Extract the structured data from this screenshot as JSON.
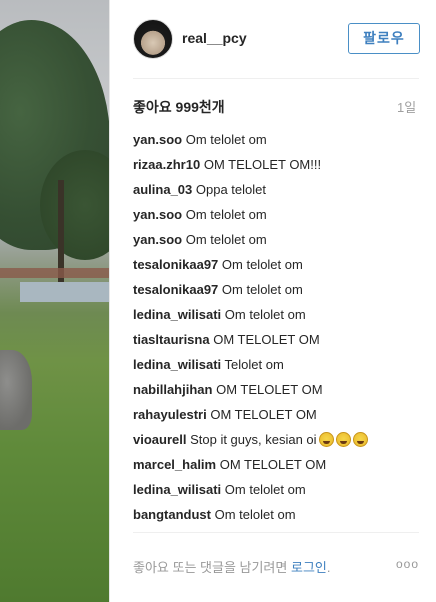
{
  "post": {
    "username": "real__pcy",
    "follow_label": "팔로우",
    "likes_text": "좋아요 999천개",
    "time_ago": "1일"
  },
  "comments": [
    {
      "user": "yan.soo",
      "text": "Om telolet om"
    },
    {
      "user": "rizaa.zhr10",
      "text": "OM TELOLET OM!!!"
    },
    {
      "user": "aulina_03",
      "text": "Oppa telolet"
    },
    {
      "user": "yan.soo",
      "text": "Om telolet om"
    },
    {
      "user": "yan.soo",
      "text": "Om telolet om"
    },
    {
      "user": "tesalonikaa97",
      "text": "Om telolet om"
    },
    {
      "user": "tesalonikaa97",
      "text": "Om telolet om"
    },
    {
      "user": "ledina_wilisati",
      "text": "Om telolet om"
    },
    {
      "user": "tiasltaurisna",
      "text": "OM TELOLET OM"
    },
    {
      "user": "ledina_wilisati",
      "text": "Telolet om"
    },
    {
      "user": "nabillahjihan",
      "text": "OM TELOLET OM"
    },
    {
      "user": "rahayulestri",
      "text": "OM TELOLET OM"
    },
    {
      "user": "vioaurell",
      "text": "Stop it guys, kesian oi",
      "emoji_icons": [
        "laughing-emoji-icon",
        "laughing-emoji-icon",
        "laughing-emoji-icon"
      ]
    },
    {
      "user": "marcel_halim",
      "text": "OM TELOLET OM"
    },
    {
      "user": "ledina_wilisati",
      "text": "Om telolet om"
    },
    {
      "user": "bangtandust",
      "text": "Om telolet om"
    }
  ],
  "footer": {
    "prompt_text": "좋아요 또는 댓글을 남기려면",
    "login_label": "로그인",
    "period": ".",
    "more_label": "ooo"
  },
  "colors": {
    "accent": "#3f80bf",
    "text": "#262626",
    "muted": "#999999",
    "divider": "#efefef"
  }
}
